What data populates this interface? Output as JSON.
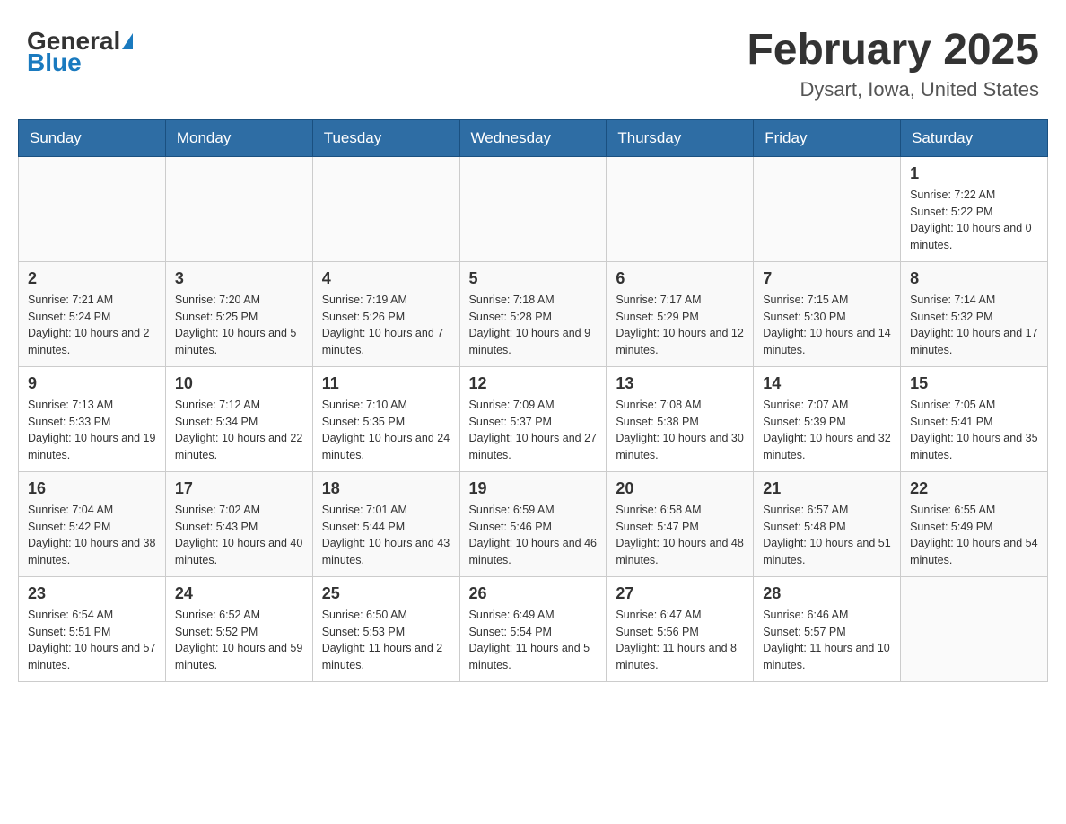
{
  "header": {
    "logo_general": "General",
    "logo_blue": "Blue",
    "month_year": "February 2025",
    "location": "Dysart, Iowa, United States"
  },
  "weekdays": [
    "Sunday",
    "Monday",
    "Tuesday",
    "Wednesday",
    "Thursday",
    "Friday",
    "Saturday"
  ],
  "weeks": [
    [
      {
        "day": "",
        "sunrise": "",
        "sunset": "",
        "daylight": ""
      },
      {
        "day": "",
        "sunrise": "",
        "sunset": "",
        "daylight": ""
      },
      {
        "day": "",
        "sunrise": "",
        "sunset": "",
        "daylight": ""
      },
      {
        "day": "",
        "sunrise": "",
        "sunset": "",
        "daylight": ""
      },
      {
        "day": "",
        "sunrise": "",
        "sunset": "",
        "daylight": ""
      },
      {
        "day": "",
        "sunrise": "",
        "sunset": "",
        "daylight": ""
      },
      {
        "day": "1",
        "sunrise": "Sunrise: 7:22 AM",
        "sunset": "Sunset: 5:22 PM",
        "daylight": "Daylight: 10 hours and 0 minutes."
      }
    ],
    [
      {
        "day": "2",
        "sunrise": "Sunrise: 7:21 AM",
        "sunset": "Sunset: 5:24 PM",
        "daylight": "Daylight: 10 hours and 2 minutes."
      },
      {
        "day": "3",
        "sunrise": "Sunrise: 7:20 AM",
        "sunset": "Sunset: 5:25 PM",
        "daylight": "Daylight: 10 hours and 5 minutes."
      },
      {
        "day": "4",
        "sunrise": "Sunrise: 7:19 AM",
        "sunset": "Sunset: 5:26 PM",
        "daylight": "Daylight: 10 hours and 7 minutes."
      },
      {
        "day": "5",
        "sunrise": "Sunrise: 7:18 AM",
        "sunset": "Sunset: 5:28 PM",
        "daylight": "Daylight: 10 hours and 9 minutes."
      },
      {
        "day": "6",
        "sunrise": "Sunrise: 7:17 AM",
        "sunset": "Sunset: 5:29 PM",
        "daylight": "Daylight: 10 hours and 12 minutes."
      },
      {
        "day": "7",
        "sunrise": "Sunrise: 7:15 AM",
        "sunset": "Sunset: 5:30 PM",
        "daylight": "Daylight: 10 hours and 14 minutes."
      },
      {
        "day": "8",
        "sunrise": "Sunrise: 7:14 AM",
        "sunset": "Sunset: 5:32 PM",
        "daylight": "Daylight: 10 hours and 17 minutes."
      }
    ],
    [
      {
        "day": "9",
        "sunrise": "Sunrise: 7:13 AM",
        "sunset": "Sunset: 5:33 PM",
        "daylight": "Daylight: 10 hours and 19 minutes."
      },
      {
        "day": "10",
        "sunrise": "Sunrise: 7:12 AM",
        "sunset": "Sunset: 5:34 PM",
        "daylight": "Daylight: 10 hours and 22 minutes."
      },
      {
        "day": "11",
        "sunrise": "Sunrise: 7:10 AM",
        "sunset": "Sunset: 5:35 PM",
        "daylight": "Daylight: 10 hours and 24 minutes."
      },
      {
        "day": "12",
        "sunrise": "Sunrise: 7:09 AM",
        "sunset": "Sunset: 5:37 PM",
        "daylight": "Daylight: 10 hours and 27 minutes."
      },
      {
        "day": "13",
        "sunrise": "Sunrise: 7:08 AM",
        "sunset": "Sunset: 5:38 PM",
        "daylight": "Daylight: 10 hours and 30 minutes."
      },
      {
        "day": "14",
        "sunrise": "Sunrise: 7:07 AM",
        "sunset": "Sunset: 5:39 PM",
        "daylight": "Daylight: 10 hours and 32 minutes."
      },
      {
        "day": "15",
        "sunrise": "Sunrise: 7:05 AM",
        "sunset": "Sunset: 5:41 PM",
        "daylight": "Daylight: 10 hours and 35 minutes."
      }
    ],
    [
      {
        "day": "16",
        "sunrise": "Sunrise: 7:04 AM",
        "sunset": "Sunset: 5:42 PM",
        "daylight": "Daylight: 10 hours and 38 minutes."
      },
      {
        "day": "17",
        "sunrise": "Sunrise: 7:02 AM",
        "sunset": "Sunset: 5:43 PM",
        "daylight": "Daylight: 10 hours and 40 minutes."
      },
      {
        "day": "18",
        "sunrise": "Sunrise: 7:01 AM",
        "sunset": "Sunset: 5:44 PM",
        "daylight": "Daylight: 10 hours and 43 minutes."
      },
      {
        "day": "19",
        "sunrise": "Sunrise: 6:59 AM",
        "sunset": "Sunset: 5:46 PM",
        "daylight": "Daylight: 10 hours and 46 minutes."
      },
      {
        "day": "20",
        "sunrise": "Sunrise: 6:58 AM",
        "sunset": "Sunset: 5:47 PM",
        "daylight": "Daylight: 10 hours and 48 minutes."
      },
      {
        "day": "21",
        "sunrise": "Sunrise: 6:57 AM",
        "sunset": "Sunset: 5:48 PM",
        "daylight": "Daylight: 10 hours and 51 minutes."
      },
      {
        "day": "22",
        "sunrise": "Sunrise: 6:55 AM",
        "sunset": "Sunset: 5:49 PM",
        "daylight": "Daylight: 10 hours and 54 minutes."
      }
    ],
    [
      {
        "day": "23",
        "sunrise": "Sunrise: 6:54 AM",
        "sunset": "Sunset: 5:51 PM",
        "daylight": "Daylight: 10 hours and 57 minutes."
      },
      {
        "day": "24",
        "sunrise": "Sunrise: 6:52 AM",
        "sunset": "Sunset: 5:52 PM",
        "daylight": "Daylight: 10 hours and 59 minutes."
      },
      {
        "day": "25",
        "sunrise": "Sunrise: 6:50 AM",
        "sunset": "Sunset: 5:53 PM",
        "daylight": "Daylight: 11 hours and 2 minutes."
      },
      {
        "day": "26",
        "sunrise": "Sunrise: 6:49 AM",
        "sunset": "Sunset: 5:54 PM",
        "daylight": "Daylight: 11 hours and 5 minutes."
      },
      {
        "day": "27",
        "sunrise": "Sunrise: 6:47 AM",
        "sunset": "Sunset: 5:56 PM",
        "daylight": "Daylight: 11 hours and 8 minutes."
      },
      {
        "day": "28",
        "sunrise": "Sunrise: 6:46 AM",
        "sunset": "Sunset: 5:57 PM",
        "daylight": "Daylight: 11 hours and 10 minutes."
      },
      {
        "day": "",
        "sunrise": "",
        "sunset": "",
        "daylight": ""
      }
    ]
  ]
}
